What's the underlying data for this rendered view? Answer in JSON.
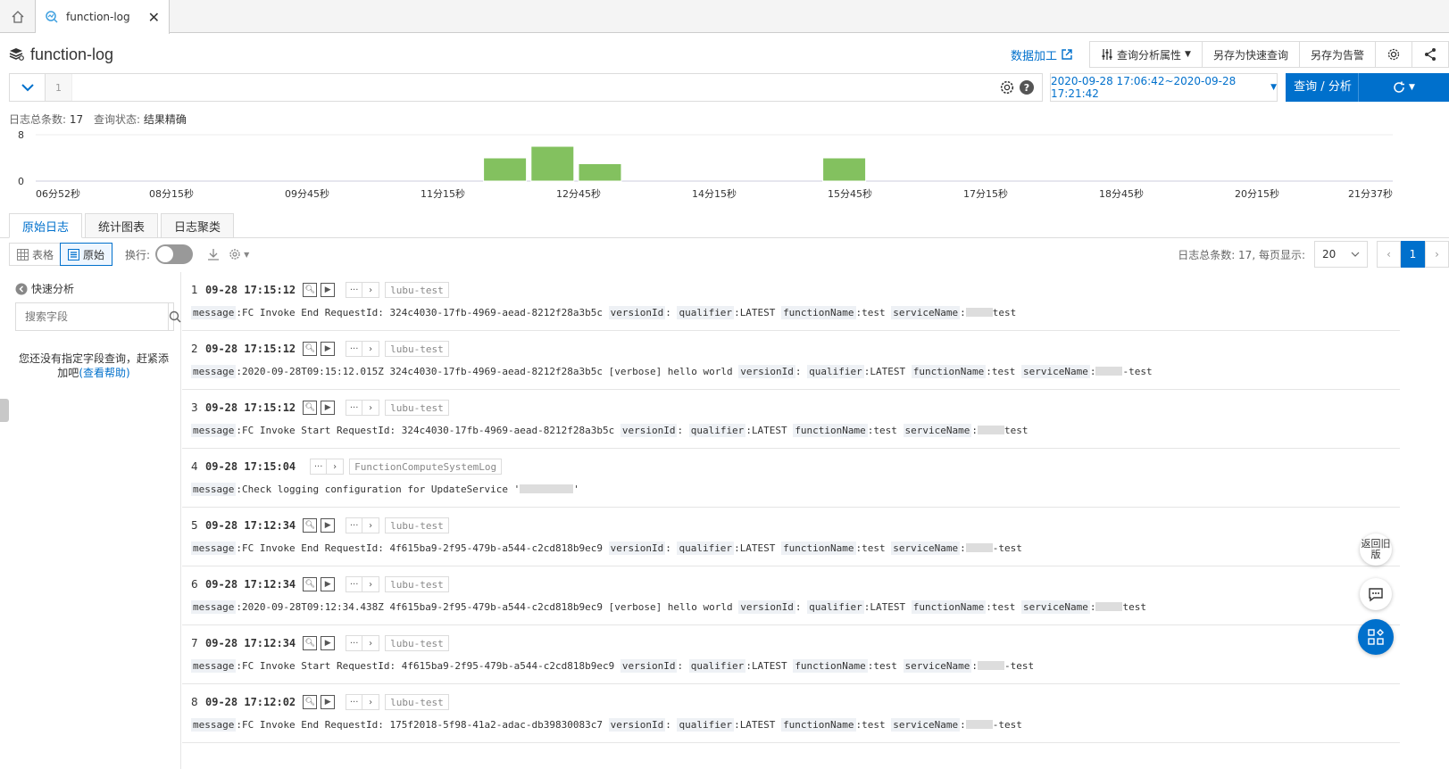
{
  "tab": {
    "label": "function-log"
  },
  "header": {
    "title": "function-log",
    "data_process": "数据加工",
    "query_props": "查询分析属性",
    "save_quick": "另存为快速查询",
    "save_alert": "另存为告警"
  },
  "query": {
    "line_no": "1",
    "time_range": "2020-09-28 17:06:42~2020-09-28 17:21:42",
    "search_label": "查询 / 分析"
  },
  "status": {
    "total_label": "日志总条数:",
    "total": "17",
    "state_label": "查询状态:",
    "state": "结果精确"
  },
  "chart_data": {
    "type": "bar",
    "y_ticks": [
      "8",
      "0"
    ],
    "x_labels": [
      "06分52秒",
      "08分15秒",
      "09分45秒",
      "11分15秒",
      "12分45秒",
      "14分15秒",
      "15分45秒",
      "17分15秒",
      "18分45秒",
      "20分15秒",
      "21分37秒"
    ],
    "ylim": [
      0,
      8
    ],
    "bars": [
      {
        "t": 0.33,
        "v": 4
      },
      {
        "t": 0.365,
        "v": 6
      },
      {
        "t": 0.4,
        "v": 3
      },
      {
        "t": 0.58,
        "v": 4
      }
    ],
    "color": "#83c15f"
  },
  "view_tabs": [
    "原始日志",
    "统计图表",
    "日志聚类"
  ],
  "toolbar": {
    "table": "表格",
    "raw": "原始",
    "wrap": "换行:"
  },
  "pager": {
    "info": "日志总条数: 17, 每页显示:",
    "size": "20",
    "page": "1"
  },
  "side": {
    "quick": "快速分析",
    "search_placeholder": "搜索字段",
    "empty_text": "您还没有指定字段查询，赶紧添加吧",
    "help": "(查看帮助)"
  },
  "fabs": {
    "back": "返回旧版"
  },
  "logs": [
    {
      "idx": "1",
      "time": "09-28 17:15:12",
      "tag": "lubu-test",
      "msg": "FC Invoke End RequestId: 324c4030-17fb-4969-aead-8212f28a3b5c",
      "svc": "test"
    },
    {
      "idx": "2",
      "time": "09-28 17:15:12",
      "tag": "lubu-test",
      "msg": "2020-09-28T09:15:12.015Z 324c4030-17fb-4969-aead-8212f28a3b5c [verbose] hello world",
      "svc": "-test"
    },
    {
      "idx": "3",
      "time": "09-28 17:15:12",
      "tag": "lubu-test",
      "msg": "FC Invoke Start RequestId: 324c4030-17fb-4969-aead-8212f28a3b5c",
      "svc": "test"
    },
    {
      "idx": "4",
      "time": "09-28 17:15:04",
      "tag": "FunctionComputeSystemLog",
      "msg": "Check logging configuration for UpdateService '"
    },
    {
      "idx": "5",
      "time": "09-28 17:12:34",
      "tag": "lubu-test",
      "msg": "FC Invoke End RequestId: 4f615ba9-2f95-479b-a544-c2cd818b9ec9",
      "svc": "-test"
    },
    {
      "idx": "6",
      "time": "09-28 17:12:34",
      "tag": "lubu-test",
      "msg": "2020-09-28T09:12:34.438Z 4f615ba9-2f95-479b-a544-c2cd818b9ec9 [verbose] hello world",
      "svc": "test"
    },
    {
      "idx": "7",
      "time": "09-28 17:12:34",
      "tag": "lubu-test",
      "msg": "FC Invoke Start RequestId: 4f615ba9-2f95-479b-a544-c2cd818b9ec9",
      "svc": "-test"
    },
    {
      "idx": "8",
      "time": "09-28 17:12:02",
      "tag": "lubu-test",
      "msg": "FC Invoke End RequestId: 175f2018-5f98-41a2-adac-db39830083c7",
      "svc": "-test"
    }
  ],
  "keys": {
    "message": "message",
    "versionId": "versionId",
    "qualifier": "qualifier",
    "functionName": "functionName",
    "serviceName": "serviceName",
    "latest": "LATEST",
    "test": "test"
  }
}
